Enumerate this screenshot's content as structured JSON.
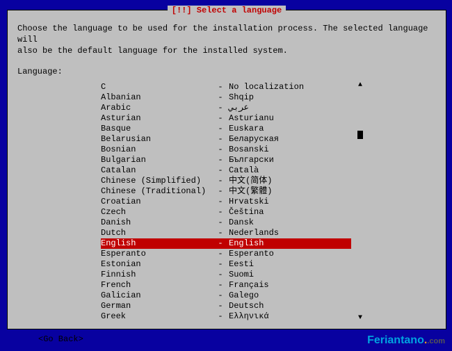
{
  "dialog": {
    "title": "[!!] Select a language",
    "instructions_line1": "Choose the language to be used for the installation process. The selected language will",
    "instructions_line2": "also be the default language for the installed system.",
    "label": "Language:",
    "go_back": "<Go Back>"
  },
  "languages": [
    {
      "name": "C",
      "native": "No localization",
      "selected": false
    },
    {
      "name": "Albanian",
      "native": "Shqip",
      "selected": false
    },
    {
      "name": "Arabic",
      "native": "عربي",
      "selected": false
    },
    {
      "name": "Asturian",
      "native": "Asturianu",
      "selected": false
    },
    {
      "name": "Basque",
      "native": "Euskara",
      "selected": false
    },
    {
      "name": "Belarusian",
      "native": "Беларуская",
      "selected": false
    },
    {
      "name": "Bosnian",
      "native": "Bosanski",
      "selected": false
    },
    {
      "name": "Bulgarian",
      "native": "Български",
      "selected": false
    },
    {
      "name": "Catalan",
      "native": "Català",
      "selected": false
    },
    {
      "name": "Chinese (Simplified)",
      "native": "中文(简体)",
      "selected": false
    },
    {
      "name": "Chinese (Traditional)",
      "native": "中文(繁體)",
      "selected": false
    },
    {
      "name": "Croatian",
      "native": "Hrvatski",
      "selected": false
    },
    {
      "name": "Czech",
      "native": "Čeština",
      "selected": false
    },
    {
      "name": "Danish",
      "native": "Dansk",
      "selected": false
    },
    {
      "name": "Dutch",
      "native": "Nederlands",
      "selected": false
    },
    {
      "name": "English",
      "native": "English",
      "selected": true
    },
    {
      "name": "Esperanto",
      "native": "Esperanto",
      "selected": false
    },
    {
      "name": "Estonian",
      "native": "Eesti",
      "selected": false
    },
    {
      "name": "Finnish",
      "native": "Suomi",
      "selected": false
    },
    {
      "name": "French",
      "native": "Français",
      "selected": false
    },
    {
      "name": "Galician",
      "native": "Galego",
      "selected": false
    },
    {
      "name": "German",
      "native": "Deutsch",
      "selected": false
    },
    {
      "name": "Greek",
      "native": "Ελληνικά",
      "selected": false
    }
  ],
  "watermark": {
    "brand": "Feriantano",
    "suffix": ".com"
  }
}
